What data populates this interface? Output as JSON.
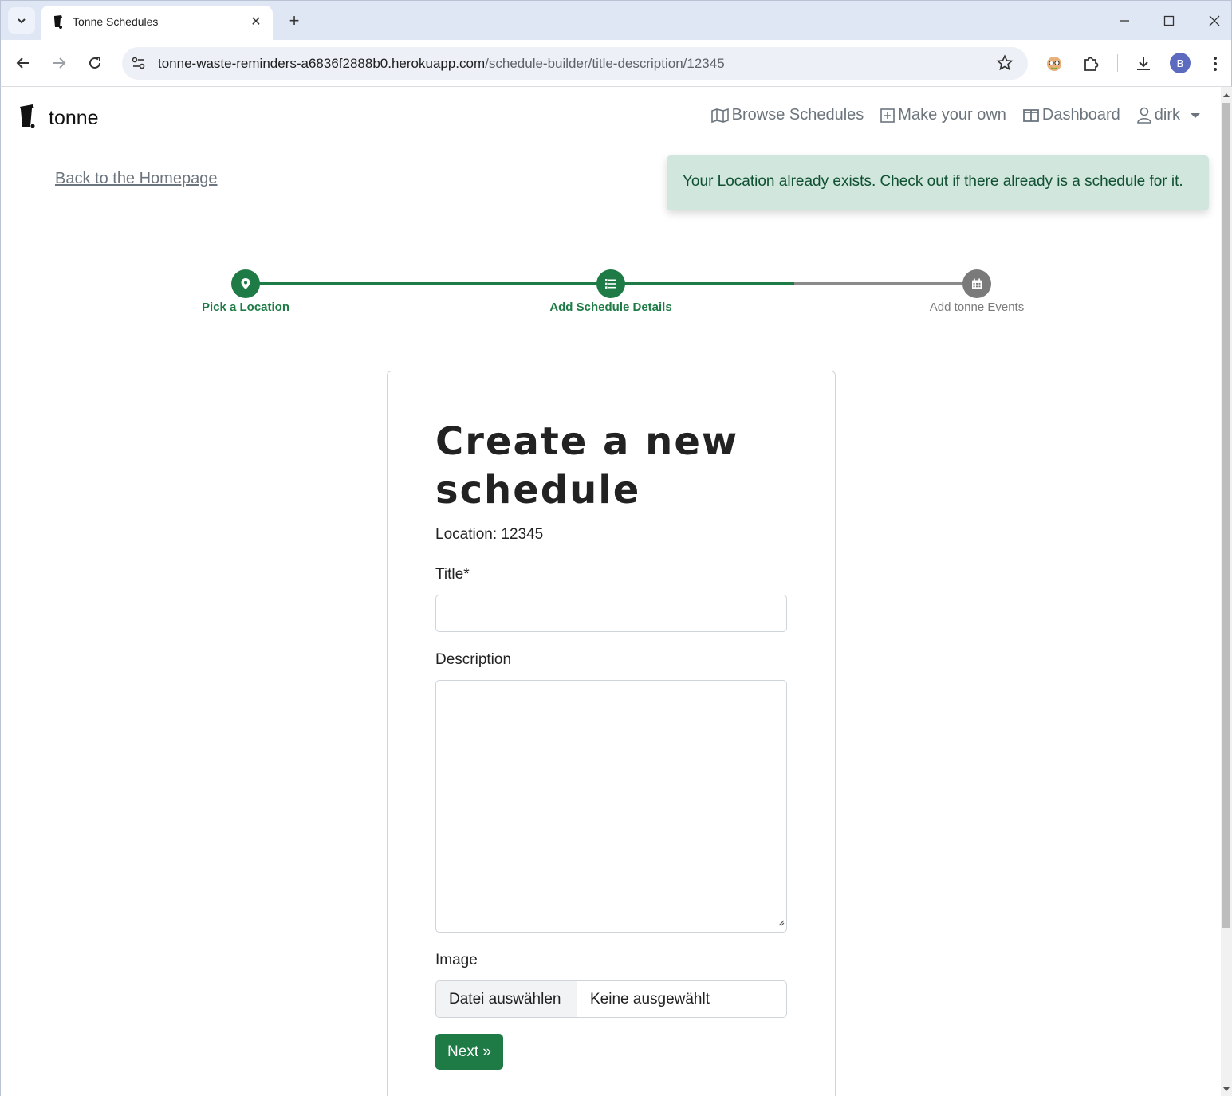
{
  "browser": {
    "tab_title": "Tonne Schedules",
    "url_host": "tonne-waste-reminders-a6836f2888b0.herokuapp.com",
    "url_path": "/schedule-builder/title-description/12345",
    "profile_initial": "B"
  },
  "nav": {
    "brand": "tonne",
    "links": [
      {
        "label": "Browse Schedules",
        "icon": "map-icon"
      },
      {
        "label": "Make your own",
        "icon": "plus-square-icon"
      },
      {
        "label": "Dashboard",
        "icon": "columns-icon"
      },
      {
        "label": "dirk",
        "icon": "person-icon"
      }
    ]
  },
  "back_link": "Back to the Homepage",
  "alert": "Your Location already exists. Check out if there already is a schedule for it.",
  "stepper": {
    "steps": [
      {
        "label": "Pick a Location",
        "state": "done",
        "icon": "map-pin-icon"
      },
      {
        "label": "Add Schedule Details",
        "state": "active",
        "icon": "list-icon"
      },
      {
        "label": "Add tonne Events",
        "state": "pending",
        "icon": "calendar-icon"
      }
    ],
    "active_color": "#1e7b46",
    "pending_color": "#7a7a7a"
  },
  "form": {
    "title": "Create a new schedule",
    "location_line": "Location: 12345",
    "title_label": "Title*",
    "title_value": "",
    "description_label": "Description",
    "description_value": "",
    "image_label": "Image",
    "file_button": "Datei auswählen",
    "file_status": "Keine ausgewählt",
    "next_label": "Next »"
  },
  "colors": {
    "primary": "#1e7b46",
    "alert_bg": "#d1e7dd",
    "alert_text": "#0f5132"
  }
}
